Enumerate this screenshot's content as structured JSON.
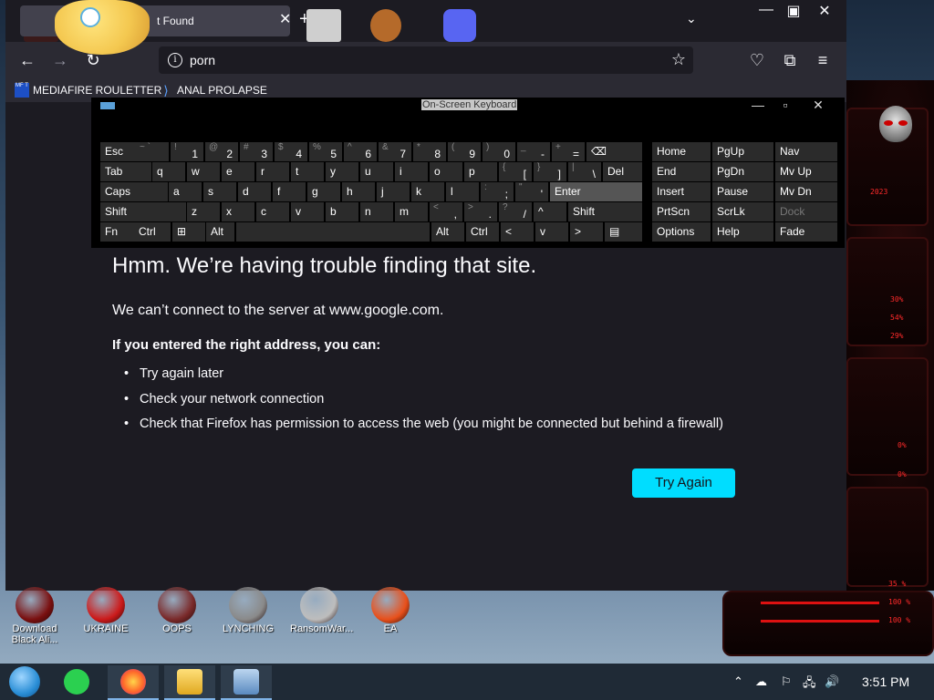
{
  "browser": {
    "tab_title": "t Found",
    "url": "porn",
    "bookmarks": [
      {
        "label": "MEDIAFIRE ROULETTER",
        "icon": "mediafire-icon",
        "icon_text": "MF T"
      },
      {
        "label": "ANAL PROLAPSE",
        "icon": "bookmark-site-icon"
      }
    ],
    "accent": "#00ddff"
  },
  "error_page": {
    "title": "Hmm. We’re having trouble finding that site.",
    "message": "We can’t connect to the server at www.google.com.",
    "subheading": "If you entered the right address, you can:",
    "suggestions": [
      "Try again later",
      "Check your network connection",
      "Check that Firefox has permission to access the web (you might be connected but behind a firewall)"
    ],
    "button": "Try Again"
  },
  "osk": {
    "title": "On-Screen Keyboard",
    "rows": {
      "row1": [
        {
          "label": "Esc"
        },
        {
          "top": "~ `",
          "bot": ""
        },
        {
          "top": "!",
          "bot": "1"
        },
        {
          "top": "@",
          "bot": "2"
        },
        {
          "top": "#",
          "bot": "3"
        },
        {
          "top": "$",
          "bot": "4"
        },
        {
          "top": "%",
          "bot": "5"
        },
        {
          "top": "^",
          "bot": "6"
        },
        {
          "top": "&",
          "bot": "7"
        },
        {
          "top": "*",
          "bot": "8"
        },
        {
          "top": "(",
          "bot": "9"
        },
        {
          "top": ")",
          "bot": "0"
        },
        {
          "top": "_",
          "bot": "-"
        },
        {
          "top": "+",
          "bot": "="
        },
        {
          "label": "⌫"
        }
      ],
      "row2": [
        {
          "label": "Tab"
        },
        {
          "label": "q"
        },
        {
          "label": "w"
        },
        {
          "label": "e"
        },
        {
          "label": "r"
        },
        {
          "label": "t"
        },
        {
          "label": "y"
        },
        {
          "label": "u"
        },
        {
          "label": "i"
        },
        {
          "label": "o"
        },
        {
          "label": "p"
        },
        {
          "top": "{",
          "bot": "["
        },
        {
          "top": "}",
          "bot": "]"
        },
        {
          "top": "|",
          "bot": "\\"
        },
        {
          "label": "Del"
        }
      ],
      "row3": [
        {
          "label": "Caps"
        },
        {
          "label": "a"
        },
        {
          "label": "s"
        },
        {
          "label": "d"
        },
        {
          "label": "f"
        },
        {
          "label": "g"
        },
        {
          "label": "h"
        },
        {
          "label": "j"
        },
        {
          "label": "k"
        },
        {
          "label": "l"
        },
        {
          "top": ":",
          "bot": ";"
        },
        {
          "top": "\"",
          "bot": "'"
        },
        {
          "label": "Enter"
        }
      ],
      "row4": [
        {
          "label": "Shift"
        },
        {
          "label": "z"
        },
        {
          "label": "x"
        },
        {
          "label": "c"
        },
        {
          "label": "v"
        },
        {
          "label": "b"
        },
        {
          "label": "n"
        },
        {
          "label": "m"
        },
        {
          "top": "<",
          "bot": ","
        },
        {
          "top": ">",
          "bot": "."
        },
        {
          "top": "?",
          "bot": "/"
        },
        {
          "label": "^"
        },
        {
          "label": "Shift"
        }
      ],
      "row5": [
        {
          "label": "Fn"
        },
        {
          "label": "Ctrl"
        },
        {
          "label": "⊞"
        },
        {
          "label": "Alt"
        },
        {
          "label": ""
        },
        {
          "label": "Alt"
        },
        {
          "label": "Ctrl"
        },
        {
          "label": "<"
        },
        {
          "label": "v"
        },
        {
          "label": ">"
        },
        {
          "label": "▤"
        }
      ]
    },
    "nav_keys": [
      [
        "Home",
        "PgUp",
        "Nav"
      ],
      [
        "End",
        "PgDn",
        "Mv Up"
      ],
      [
        "Insert",
        "Pause",
        "Mv Dn"
      ],
      [
        "PrtScn",
        "ScrLk",
        "Dock"
      ],
      [
        "Options",
        "Help",
        "Fade"
      ]
    ]
  },
  "desktop_icons": [
    {
      "label": "Download Black Ali...",
      "icon": "download-icon",
      "color": "#7a1010"
    },
    {
      "label": "UKRAINE",
      "icon": "radiation-icon",
      "color": "#cc1a1a"
    },
    {
      "label": "OOPS",
      "icon": "oops-icon",
      "color": "#7a2a2a"
    },
    {
      "label": "LYNCHING",
      "icon": "flag-icon",
      "color": "#8a8a8a"
    },
    {
      "label": "RansomWar...",
      "icon": "skull-icon",
      "color": "#bdbdbd"
    },
    {
      "label": "EA",
      "icon": "ea-icon",
      "color": "#e8501b"
    }
  ],
  "wallpaper_text": {
    "p1": "30%",
    "p2": "54%",
    "p3": "29%",
    "p4": "0%",
    "p5": "0%",
    "p6": "35 %",
    "p7": "100 %",
    "p8": "100 %",
    "p9": "2023"
  },
  "taskbar": {
    "apps": [
      {
        "icon": "start-orb-icon",
        "color": "#2a8ed6"
      },
      {
        "icon": "notes-app-icon",
        "color": "#2bd050"
      },
      {
        "icon": "firefox-icon",
        "color": "#ff6a2a"
      },
      {
        "icon": "file-explorer-icon",
        "color": "#f0c030"
      },
      {
        "icon": "on-screen-keyboard-icon",
        "color": "#5a8ac0"
      }
    ],
    "clock": "3:51 PM"
  }
}
